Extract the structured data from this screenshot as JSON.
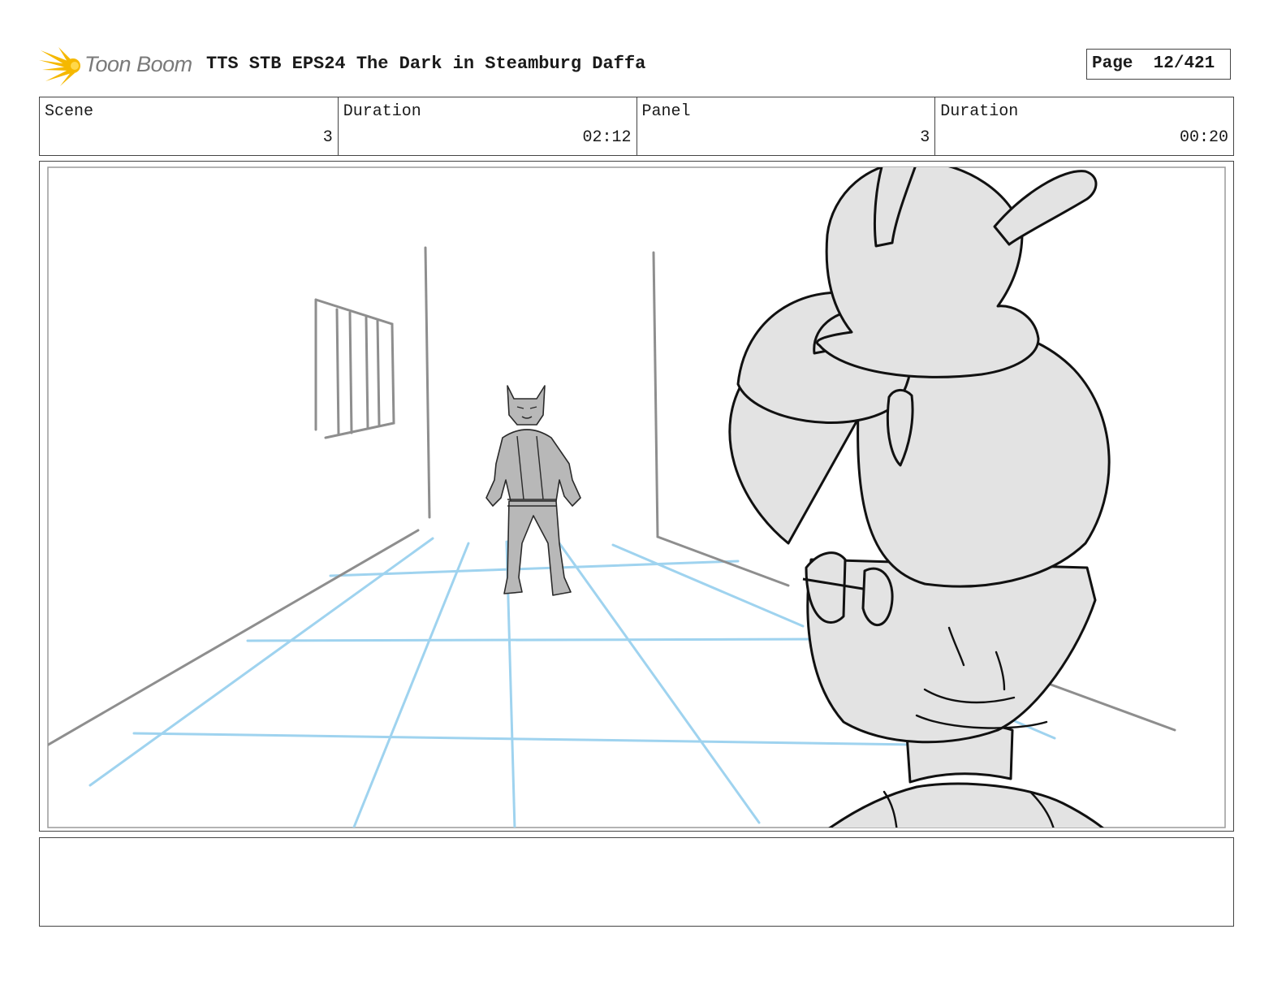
{
  "header": {
    "logo_text": "Toon Boom",
    "title": "TTS STB EPS24 The Dark in Steamburg Daffa",
    "page_label": "Page",
    "page_value": "12/421"
  },
  "info": [
    {
      "label": "Scene",
      "value": "3"
    },
    {
      "label": "Duration",
      "value": "02:12"
    },
    {
      "label": "Panel",
      "value": "3"
    },
    {
      "label": "Duration",
      "value": "00:20"
    }
  ],
  "colors": {
    "logo_accent": "#f5b800",
    "perspective_grid": "#9fd3ef",
    "character_fill": "#e3e3e3"
  },
  "notes": {
    "text": ""
  }
}
